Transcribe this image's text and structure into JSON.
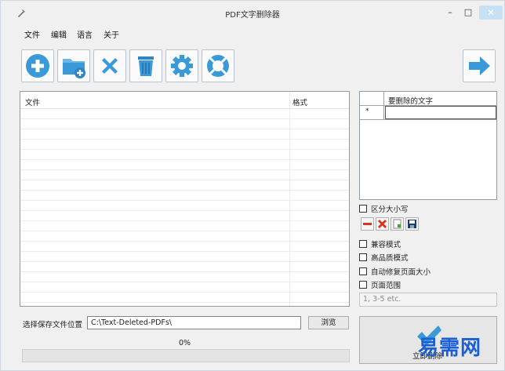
{
  "window": {
    "title": "PDF文字删除器",
    "controls": {
      "minimize": "–",
      "maximize": "□",
      "close": "×"
    }
  },
  "menu": [
    "文件",
    "编辑",
    "语言",
    "关于"
  ],
  "toolbar": {
    "buttons": [
      "add-file",
      "add-folder",
      "remove",
      "clear",
      "settings",
      "help"
    ],
    "next": "next-arrow"
  },
  "file_table": {
    "col_file": "文件",
    "col_format": "格式",
    "rows": []
  },
  "text_table": {
    "header": "要删除的文字",
    "row_marker": "*",
    "rows": []
  },
  "options": {
    "case_sensitive": "区分大小写",
    "compat_mode": "兼容模式",
    "high_quality": "高品质模式",
    "auto_fix_page_size": "自动修复页面大小",
    "page_range": "页面范围",
    "page_range_placeholder": "1, 3-5 etc."
  },
  "bottom": {
    "save_label": "选择保存文件位置",
    "save_path": "C:\\Text-Deleted-PDFs\\",
    "browse": "浏览",
    "progress": "0%",
    "progress_value": 0,
    "start": "立即删除"
  },
  "watermark": "易需网",
  "colors": {
    "blue_icon": "#3a9ad9",
    "red_icon": "#e0301e",
    "close_button": "#c7e0f4"
  }
}
